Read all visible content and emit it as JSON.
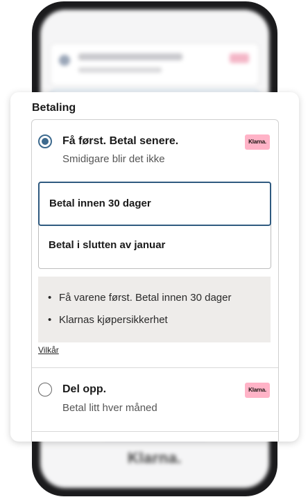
{
  "card": {
    "title": "Betaling"
  },
  "options": [
    {
      "title": "Få først. Betal senere.",
      "subtitle": "Smidigare blir det ikke",
      "badge": "Klarna.",
      "selected": true
    },
    {
      "title": "Del opp.",
      "subtitle": "Betal litt hver måned",
      "badge": "Klarna.",
      "selected": false
    }
  ],
  "plans": [
    {
      "label": "Betal innen 30 dager",
      "selected": true
    },
    {
      "label": "Betal i slutten av januar",
      "selected": false
    }
  ],
  "info": {
    "bullets": [
      "Få varene først. Betal innen 30 dager",
      "Klarnas kjøpersikkerhet"
    ],
    "terms_link": "Vilkår"
  },
  "background_screen": {
    "footer_logo": "Klarna."
  },
  "colors": {
    "accent": "#3d6a8e",
    "selected_border": "#2f5a80",
    "klarna_pink": "#ffb3c7",
    "info_bg": "#eeecea"
  }
}
